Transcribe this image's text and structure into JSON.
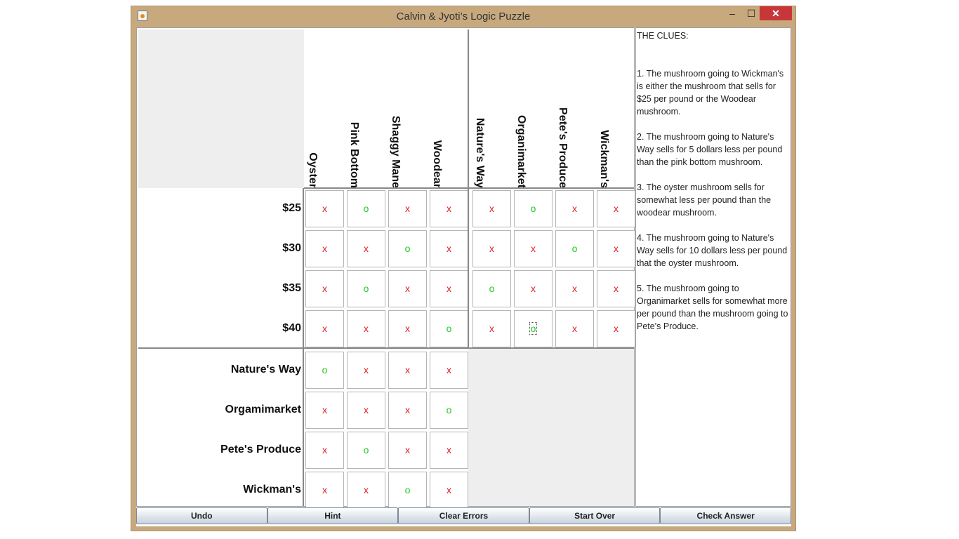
{
  "window": {
    "title": "Calvin & Jyoti’s Logic Puzzle",
    "min_glyph": "–",
    "max_glyph": "☐",
    "close_glyph": "✕"
  },
  "columns_group1": [
    "Oyster",
    "Pink Bottom",
    "Shaggy Mane",
    "Woodear"
  ],
  "columns_group2": [
    "Nature's Way",
    "Organimarket",
    "Pete's Produce",
    "Wickman's"
  ],
  "rows_group1": [
    "$25",
    "$30",
    "$35",
    "$40"
  ],
  "rows_group2": [
    "Nature's Way",
    "Orgamimarket",
    "Pete's Produce",
    "Wickman's"
  ],
  "grid_top_left": [
    [
      "x",
      "o",
      "x",
      "x"
    ],
    [
      "x",
      "x",
      "o",
      "x"
    ],
    [
      "x",
      "o",
      "x",
      "x"
    ],
    [
      "x",
      "x",
      "x",
      "o"
    ]
  ],
  "grid_top_right": [
    [
      "x",
      "o",
      "x",
      "x"
    ],
    [
      "x",
      "x",
      "o",
      "x"
    ],
    [
      "o",
      "x",
      "x",
      "x"
    ],
    [
      "x",
      "o",
      "x",
      "x"
    ]
  ],
  "grid_bottom_left": [
    [
      "o",
      "x",
      "x",
      "x"
    ],
    [
      "x",
      "x",
      "x",
      "o"
    ],
    [
      "x",
      "o",
      "x",
      "x"
    ],
    [
      "x",
      "x",
      "o",
      "x"
    ]
  ],
  "colors": {
    "x": "#e02020",
    "o": "#22cc22",
    "close": "#c7373a"
  },
  "clues": {
    "title": "THE CLUES:",
    "items": [
      "1. The mushroom going to Wickman's is either the mushroom that sells for $25 per pound or the Woodear mushroom.",
      "2. The mushroom going to Nature's Way sells for 5 dollars less per pound than the pink bottom mushroom.",
      "3. The oyster mushroom sells for somewhat less per pound than the woodear mushroom.",
      "4. The mushroom going to Nature's Way sells for 10 dollars less per pound that the oyster mushroom.",
      "5. The mushroom going to Organimarket sells for somewhat more per pound than the mushroom going to Pete's Produce."
    ]
  },
  "buttons": {
    "undo": "Undo",
    "hint": "Hint",
    "clear_errors": "Clear Errors",
    "start_over": "Start Over",
    "check_answer": "Check Answer"
  }
}
